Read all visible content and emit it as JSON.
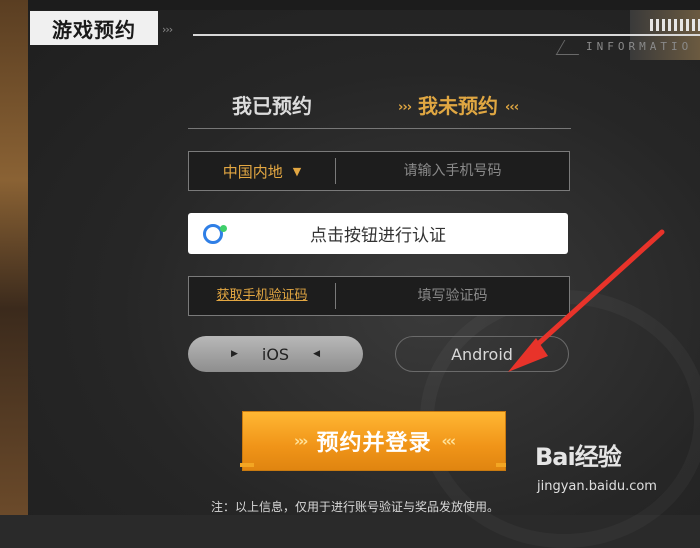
{
  "header": {
    "title": "游戏预约",
    "info_label": "INFORMATIO"
  },
  "tabs": {
    "reserved_label": "我已预约",
    "unreserved_label": "我未预约",
    "chevrons_left": "›››",
    "chevrons_right": "‹‹‹"
  },
  "phone": {
    "region_value": "中国内地",
    "region_options_visible": [
      "中国内地"
    ],
    "placeholder": "请输入手机号码"
  },
  "verify": {
    "label": "点击按钮进行认证"
  },
  "code": {
    "get_code_label": "获取手机验证码",
    "placeholder": "填写验证码"
  },
  "platform": {
    "ios_label": "iOS",
    "android_label": "Android",
    "selected": "iOS"
  },
  "submit": {
    "label": "预约并登录",
    "chevrons_left": "›››",
    "chevrons_right": "‹‹‹"
  },
  "note": "注：以上信息，仅用于进行账号验证与奖品发放使用。",
  "watermark": {
    "logo_text": "Bai经验",
    "site": "jingyan.baidu.com"
  },
  "colors": {
    "accent_gold": "#e3a742",
    "submit_orange": "#f09418",
    "annotation_red": "#e8332a"
  }
}
